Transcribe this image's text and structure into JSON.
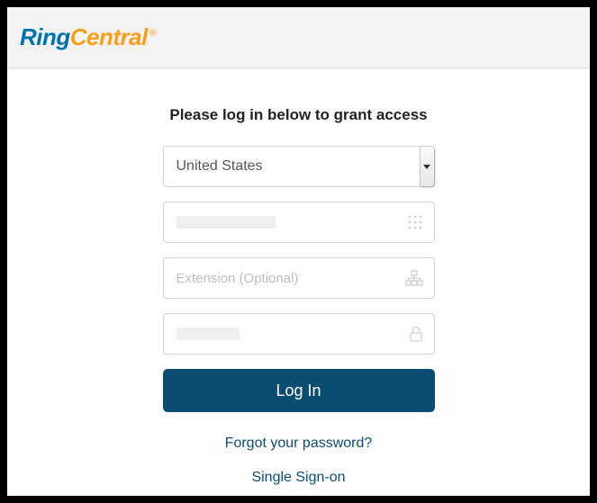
{
  "logo": {
    "part1": "Ring",
    "part2": "Central",
    "reg": "®"
  },
  "heading": "Please log in below to grant access",
  "country": {
    "selected": "United States"
  },
  "phone": {
    "value": ""
  },
  "extension": {
    "placeholder": "Extension (Optional)"
  },
  "password": {
    "value": ""
  },
  "login_label": "Log In",
  "forgot_label": "Forgot your password?",
  "sso_label": "Single Sign-on"
}
